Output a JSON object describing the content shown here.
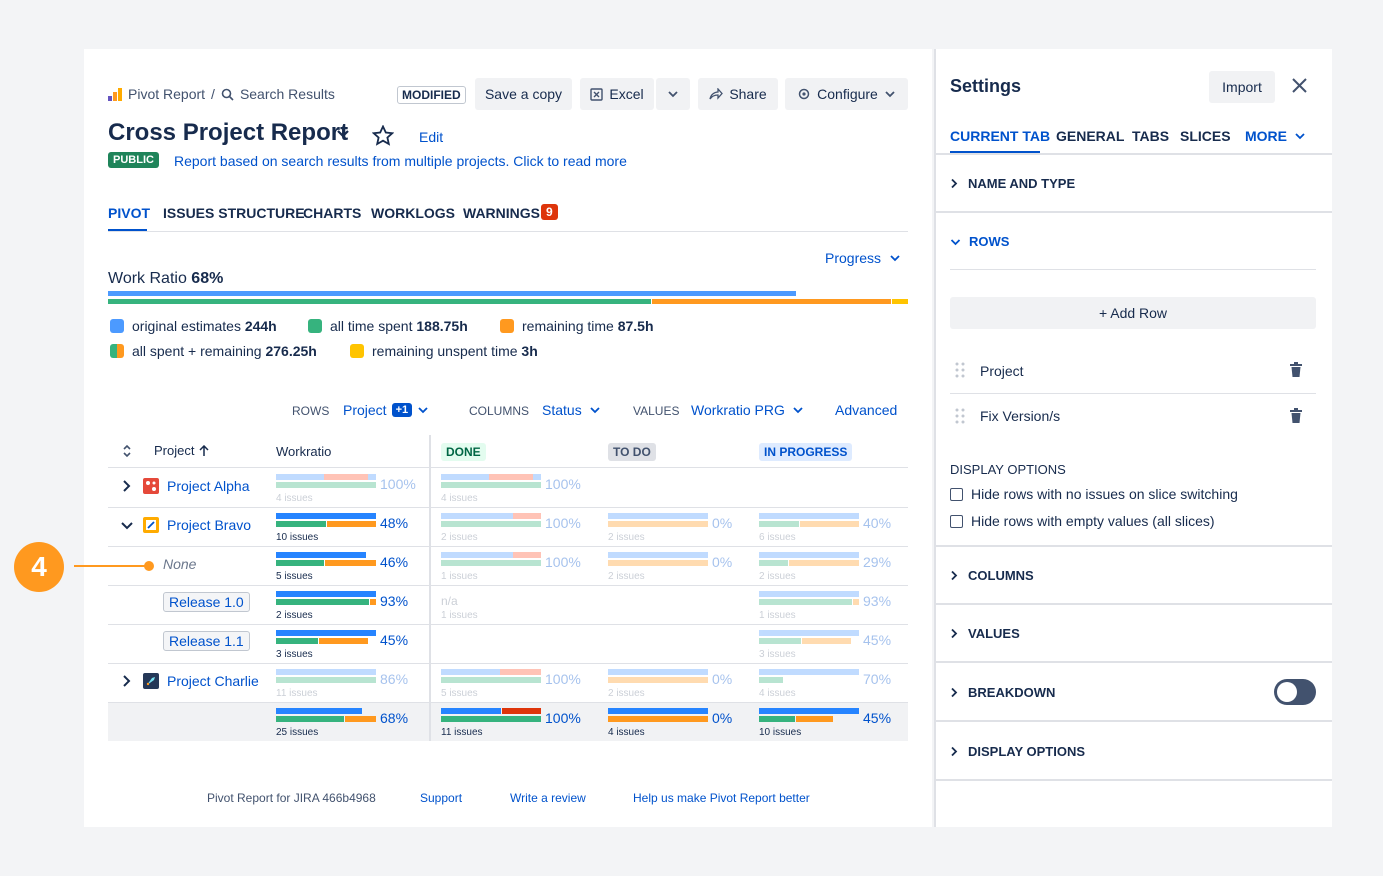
{
  "breadcrumb": {
    "root": "Pivot Report",
    "sep": "/",
    "current": "Search Results"
  },
  "header": {
    "modified_label": "MODIFIED",
    "save_copy_label": "Save a copy",
    "excel_label": "Excel",
    "share_label": "Share",
    "configure_label": "Configure",
    "title": "Cross Project Report",
    "edit_label": "Edit",
    "public_badge": "PUBLIC",
    "description": "Report based on search results from multiple projects. Click to read more"
  },
  "tabs": [
    {
      "label": "PIVOT"
    },
    {
      "label": "ISSUES STRUCTURE"
    },
    {
      "label": "CHARTS"
    },
    {
      "label": "WORKLOGS"
    },
    {
      "label": "WARNINGS",
      "count": "9"
    }
  ],
  "progress_dropdown": "Progress",
  "work_ratio": {
    "label": "Work Ratio",
    "value": "68%",
    "blue_fraction": 0.86,
    "green_fraction": 0.68,
    "orange_fraction": 0.3,
    "yellow_fraction": 0.02
  },
  "legend": [
    {
      "label": "original estimates",
      "value": "244h",
      "color": "#4c9aff"
    },
    {
      "label": "all time spent",
      "value": "188.75h",
      "color": "#36b37e"
    },
    {
      "label": "remaining time",
      "value": "87.5h",
      "color": "#ff991f"
    },
    {
      "label": "all spent + remaining",
      "value": "276.25h",
      "color": "mixed"
    },
    {
      "label": "remaining unspent time",
      "value": "3h",
      "color": "#ffc400"
    }
  ],
  "controls": {
    "rows_label": "ROWS",
    "rows_value": "Project",
    "rows_extra": "+1",
    "columns_label": "COLUMNS",
    "columns_value": "Status",
    "values_label": "VALUES",
    "values_value": "Workratio PRG",
    "advanced_label": "Advanced"
  },
  "table": {
    "col_project": "Project",
    "col_workratio": "Workratio",
    "statuses": [
      "DONE",
      "TO DO",
      "IN PROGRESS"
    ],
    "rows": [
      {
        "name": "Project Alpha",
        "wr": "100%",
        "wr_issues": "4 issues",
        "done": "100%",
        "done_issues": "4 issues"
      },
      {
        "name": "Project Bravo",
        "wr": "48%",
        "wr_issues": "10 issues",
        "done": "100%",
        "done_issues": "2 issues",
        "todo": "0%",
        "todo_issues": "2 issues",
        "prog": "40%",
        "prog_issues": "6 issues"
      },
      {
        "name": "None",
        "wr": "46%",
        "wr_issues": "5 issues",
        "done": "100%",
        "done_issues": "1 issues",
        "todo": "0%",
        "todo_issues": "2 issues",
        "prog": "29%",
        "prog_issues": "2 issues"
      },
      {
        "name": "Release 1.0",
        "wr": "93%",
        "wr_issues": "2 issues",
        "done": "n/a",
        "done_issues": "1 issues",
        "prog": "93%",
        "prog_issues": "1 issues"
      },
      {
        "name": "Release 1.1",
        "wr": "45%",
        "wr_issues": "3 issues",
        "prog": "45%",
        "prog_issues": "3 issues"
      },
      {
        "name": "Project Charlie",
        "wr": "86%",
        "wr_issues": "11 issues",
        "done": "100%",
        "done_issues": "5 issues",
        "todo": "0%",
        "todo_issues": "2 issues",
        "prog": "70%",
        "prog_issues": "4 issues"
      },
      {
        "name": "",
        "wr": "68%",
        "wr_issues": "25 issues",
        "done": "100%",
        "done_issues": "11 issues",
        "todo": "0%",
        "todo_issues": "4 issues",
        "prog": "45%",
        "prog_issues": "10 issues"
      }
    ]
  },
  "callout": {
    "number": "4"
  },
  "footer": {
    "version": "Pivot Report for JIRA 466b4968",
    "support": "Support",
    "review": "Write a review",
    "help": "Help us make Pivot Report better"
  },
  "settings": {
    "title": "Settings",
    "import_label": "Import",
    "tabs": [
      "CURRENT TAB",
      "GENERAL",
      "TABS",
      "SLICES",
      "MORE"
    ],
    "name_and_type": "NAME AND TYPE",
    "rows": "ROWS",
    "add_row": "+ Add Row",
    "row_items": [
      "Project",
      "Fix Version/s"
    ],
    "display_options_heading": "DISPLAY OPTIONS",
    "check1": "Hide rows with no issues on slice switching",
    "check2": "Hide rows with empty values (all slices)",
    "columns": "COLUMNS",
    "values": "VALUES",
    "breakdown": "BREAKDOWN",
    "display_options": "DISPLAY OPTIONS"
  }
}
